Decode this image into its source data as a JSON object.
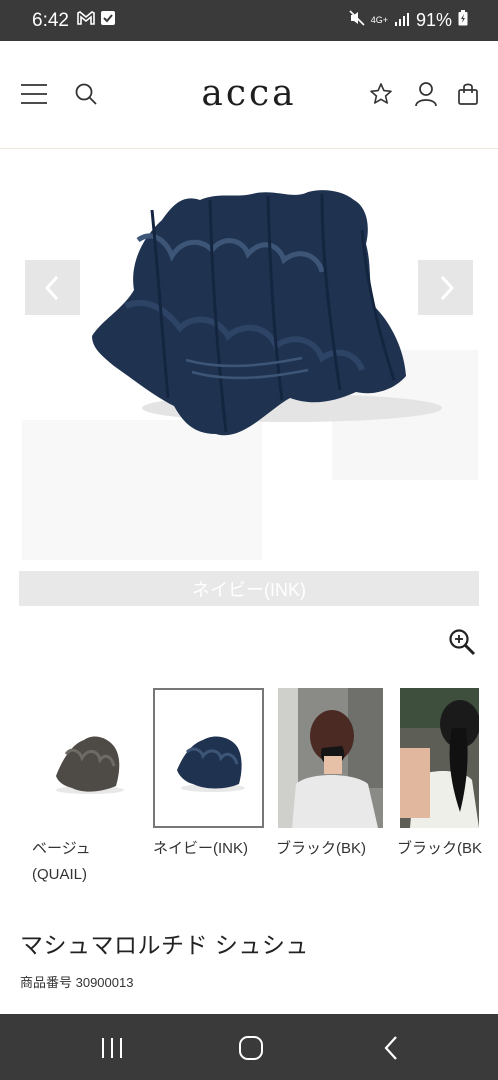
{
  "status_bar": {
    "time": "6:42",
    "network": "4G+",
    "battery": "91%"
  },
  "header": {
    "logo": "acca",
    "icons": [
      "menu-icon",
      "search-icon",
      "star-icon",
      "user-icon",
      "cart-icon"
    ]
  },
  "product": {
    "selected_color_label": "ネイビー(INK)",
    "title": "マシュマロルチド シュシュ",
    "number": "商品番号 30900013"
  },
  "thumbnails": [
    {
      "label_line1": "ベージュ",
      "label_line2": "(QUAIL)",
      "selected": false
    },
    {
      "label_line1": "ネイビー(INK)",
      "selected": true
    },
    {
      "label_line1": "ブラック(BK)",
      "selected": false
    },
    {
      "label_line1": "ブラック(BK",
      "selected": false
    }
  ],
  "colors": {
    "status_bar_bg": "#3a3a3a",
    "navy_scrunchie": "#1f3350",
    "label_bar_bg": "#e8e8e8"
  }
}
